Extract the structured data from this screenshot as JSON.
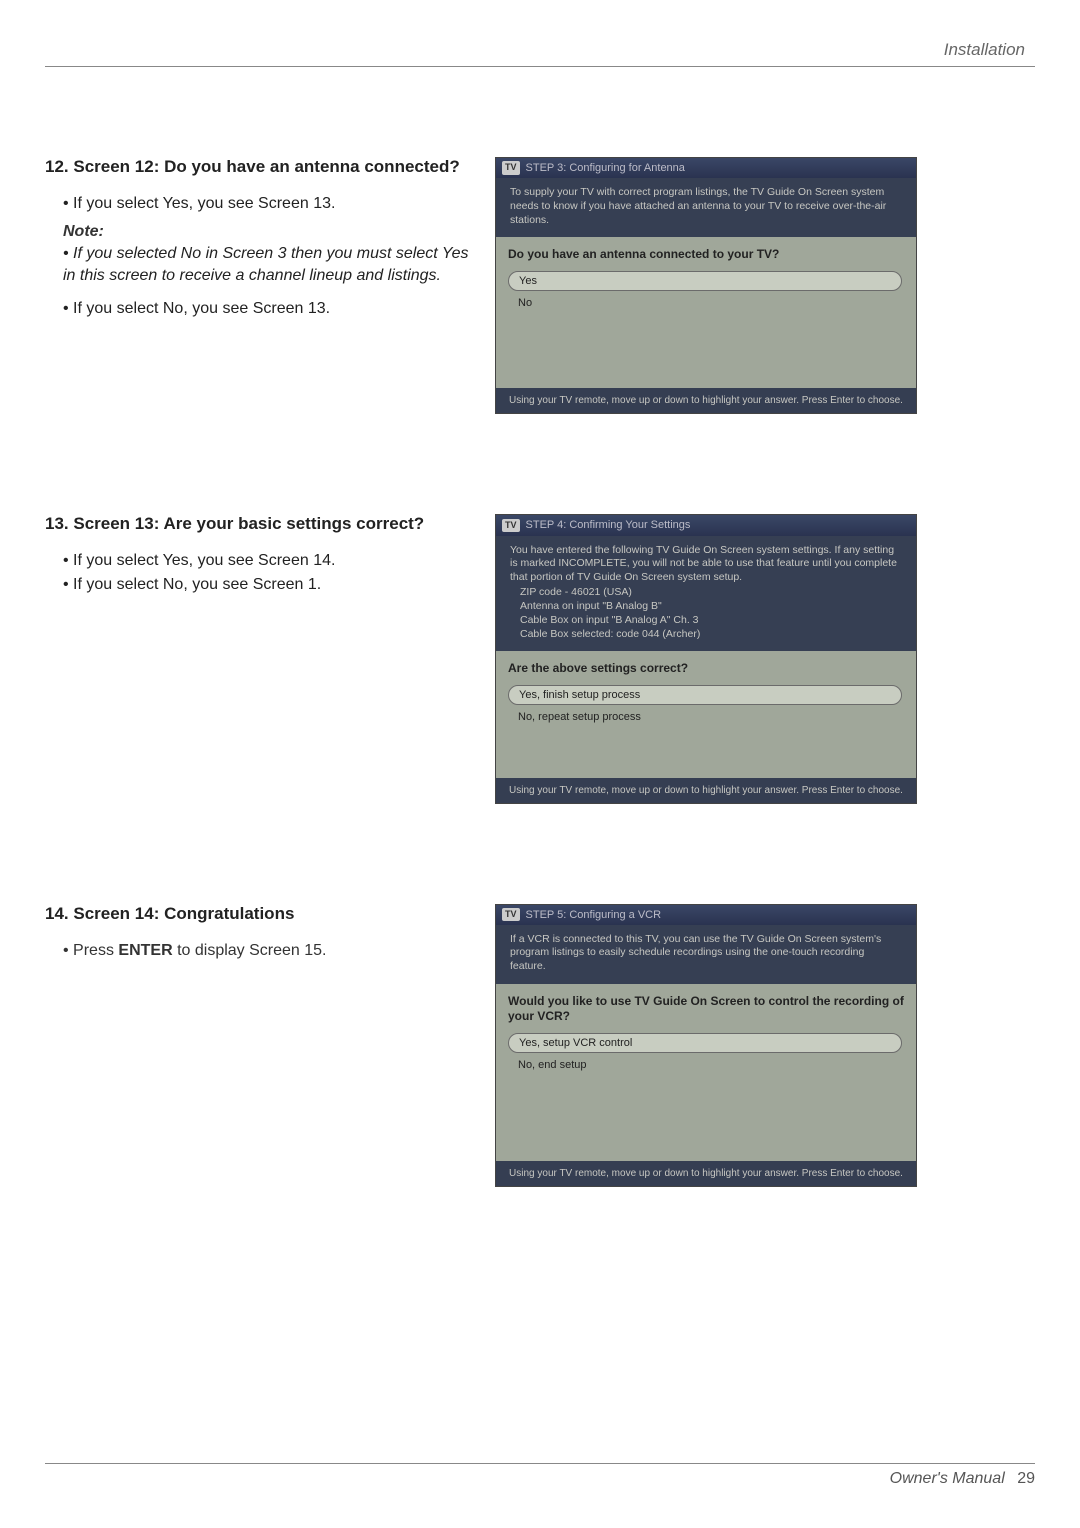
{
  "header": {
    "section_title": "Installation"
  },
  "step12": {
    "heading": "12. Screen 12: Do you have an antenna connected?",
    "bullet_yes": "If you select Yes, you see Screen 13.",
    "note_label": "Note:",
    "note_body": "• If you selected No in Screen 3 then you must select Yes in this screen to receive a channel lineup and listings.",
    "bullet_no": "If you select No, you see Screen 13.",
    "tv": {
      "title": "STEP 3: Configuring for Antenna",
      "topline": "To supply your TV with correct program listings, the TV Guide On Screen system needs to know if you have attached an antenna to your TV to receive over-the-air stations.",
      "question": "Do you have an antenna connected to your TV?",
      "opt_yes": "Yes",
      "opt_no": "No",
      "bottom": "Using your TV remote, move up or down to highlight your answer.  Press Enter to choose."
    }
  },
  "step13": {
    "heading": "13. Screen 13: Are your basic settings correct?",
    "bullet_yes": "If you select Yes, you see Screen 14.",
    "bullet_no": "If you select No, you see Screen 1.",
    "tv": {
      "title": "STEP 4: Confirming Your Settings",
      "topline": "You have entered the following TV Guide On Screen system settings. If any setting is marked INCOMPLETE, you will not be able to use that feature until you complete that portion of TV Guide On Screen system setup.",
      "line1": "ZIP code - 46021 (USA)",
      "line2": "Antenna on input \"B Analog B\"",
      "line3": "Cable Box on input \"B Analog A\" Ch. 3",
      "line4": "Cable Box selected: code 044 (Archer)",
      "question": "Are the above settings correct?",
      "opt_yes": "Yes, finish setup process",
      "opt_no": "No, repeat setup process",
      "bottom": "Using your TV remote, move up or down to highlight your answer.  Press Enter to choose."
    }
  },
  "step14": {
    "heading": "14. Screen 14: Congratulations",
    "press_prefix": "Press ",
    "press_bold": "ENTER",
    "press_suffix": " to display Screen 15.",
    "tv": {
      "title": "STEP 5: Configuring a VCR",
      "topline": "If a VCR is connected to this TV, you can use the TV Guide On Screen system's program listings to easily schedule recordings using the one-touch recording feature.",
      "question": "Would you like to use TV Guide On Screen to control the recording of your VCR?",
      "opt_yes": "Yes, setup VCR control",
      "opt_no": "No, end setup",
      "bottom": "Using your TV remote, move up or down to highlight your answer.  Press Enter to choose."
    }
  },
  "footer": {
    "label": "Owner's Manual",
    "page": "29"
  }
}
